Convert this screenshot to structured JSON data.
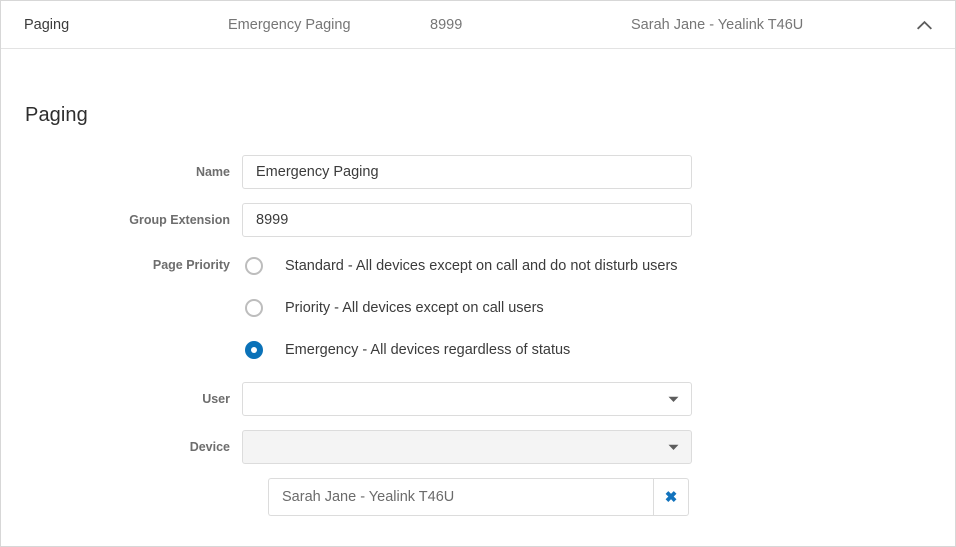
{
  "summary": {
    "title": "Paging",
    "name": "Emergency Paging",
    "extension": "8999",
    "device": "Sarah Jane - Yealink T46U",
    "collapse_icon": "chevron-up-icon"
  },
  "page": {
    "heading": "Paging"
  },
  "form": {
    "name": {
      "label": "Name",
      "value": "Emergency Paging",
      "placeholder": ""
    },
    "group_extension": {
      "label": "Group Extension",
      "value": "8999",
      "placeholder": ""
    },
    "page_priority": {
      "label": "Page Priority",
      "options": [
        {
          "label": "Standard - All devices except on call and do not disturb users",
          "selected": false
        },
        {
          "label": "Priority - All devices except on call users",
          "selected": false
        },
        {
          "label": "Emergency - All devices regardless of status",
          "selected": true
        }
      ]
    },
    "user": {
      "label": "User",
      "value": "",
      "caret_icon": "chevron-down-icon"
    },
    "device": {
      "label": "Device",
      "value": "",
      "disabled": true,
      "caret_icon": "chevron-down-icon"
    },
    "selected_devices": [
      {
        "value": "Sarah Jane - Yealink T46U",
        "remove_label": "✖",
        "remove_icon": "close-x-icon"
      }
    ]
  },
  "colors": {
    "accent": "#0b72b8",
    "link": "#1273bd",
    "label_text": "#6d6d6d",
    "body_text": "#3b3b3b",
    "muted_text": "#767676",
    "border": "#dcdcdc",
    "card_border": "#d7d7d7",
    "disabled_bg": "#f4f4f4"
  }
}
